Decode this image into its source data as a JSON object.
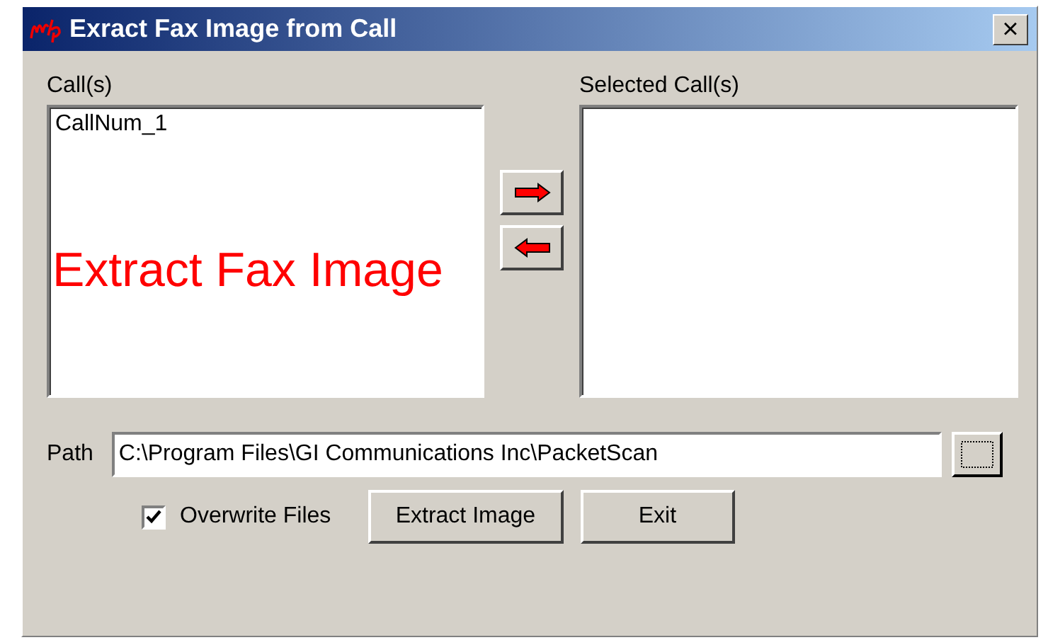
{
  "window": {
    "title": "Exract Fax Image from Call",
    "close": "×"
  },
  "calls": {
    "label": "Call(s)",
    "items": [
      "CallNum_1"
    ]
  },
  "annotation": "Extract Fax Image",
  "selected_calls": {
    "label": "Selected Call(s)"
  },
  "path": {
    "label": "Path",
    "value": "C:\\Program Files\\GI Communications Inc\\PacketScan"
  },
  "overwrite": {
    "label": "Overwrite Files",
    "checked": true
  },
  "buttons": [
    {
      "label": "Extract Image"
    },
    {
      "label": "Exit"
    }
  ]
}
